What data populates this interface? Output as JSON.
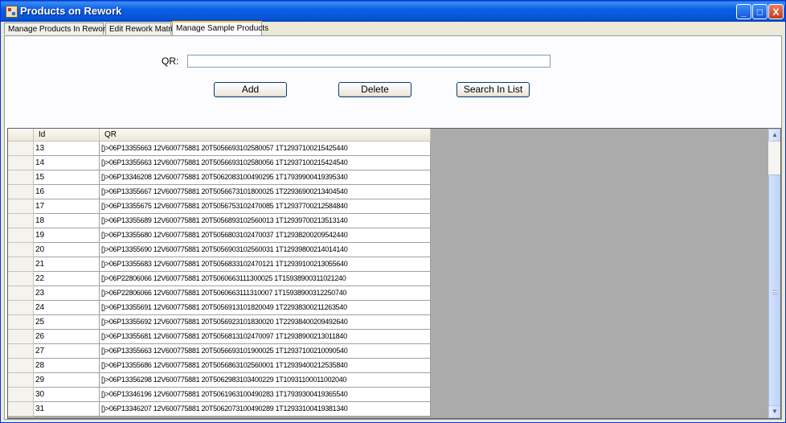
{
  "window": {
    "title": "Products on Rework",
    "minimize": "_",
    "maximize": "□",
    "close": "X"
  },
  "tabs": [
    {
      "label": "Manage Products In Rework"
    },
    {
      "label": "Edit Rework Matrix"
    },
    {
      "label": "Manage Sample Products"
    }
  ],
  "form": {
    "qr_label": "QR:",
    "qr_value": "",
    "add_label": "Add",
    "delete_label": "Delete",
    "search_label": "Search In List"
  },
  "grid": {
    "columns": [
      "Id",
      "QR"
    ],
    "rows": [
      {
        "id": "13",
        "qr": "[)>06P13355663 12V600775881 20T5056693102580057 1T12937100215425440"
      },
      {
        "id": "14",
        "qr": "[)>06P13355663 12V600775881 20T5056693102580056 1T12937100215424540"
      },
      {
        "id": "15",
        "qr": "[)>06P13346208 12V600775881 20T5062083100490295 1T17939900419395340"
      },
      {
        "id": "16",
        "qr": "[)>06P13355667 12V600775881 20T5056673101800025 1T22936900213404540"
      },
      {
        "id": "17",
        "qr": "[)>06P13355675 12V600775881 20T5056753102470085 1T12937700212584840"
      },
      {
        "id": "18",
        "qr": "[)>06P13355689 12V600775881 20T5056893102560013 1T12939700213513140"
      },
      {
        "id": "19",
        "qr": "[)>06P13355680 12V600775881 20T5056803102470037 1T12938200209542440"
      },
      {
        "id": "20",
        "qr": "[)>06P13355690 12V600775881 20T5056903102560031 1T12939800214014140"
      },
      {
        "id": "21",
        "qr": "[)>06P13355683 12V600775881 20T5056833102470121 1T12939100213055640"
      },
      {
        "id": "22",
        "qr": "[)>06P22806066 12V600775881 20T5060663111300025 1T15938900311021240"
      },
      {
        "id": "23",
        "qr": "[)>06P22806066 12V600775881 20T5060663111310007 1T15938900312250740"
      },
      {
        "id": "24",
        "qr": "[)>06P13355691 12V600775881 20T5056913101820049 1T22938300211263540"
      },
      {
        "id": "25",
        "qr": "[)>06P13355692 12V600775881 20T5056923101830020 1T22938400209492640"
      },
      {
        "id": "26",
        "qr": "[)>06P13355681 12V600775881 20T5056813102470097 1T12938900213011840"
      },
      {
        "id": "27",
        "qr": "[)>06P13355663 12V600775881 20T5056693101900025 1T12937100210090540"
      },
      {
        "id": "28",
        "qr": "[)>06P13355686 12V600775881 20T5056863102560001 1T12939400212535840"
      },
      {
        "id": "29",
        "qr": "[)>06P13356298 12V600775881 20T5062983103400229 1T10931100011002040"
      },
      {
        "id": "30",
        "qr": "[)>06P13346196 12V600775881 20T5061963100490283 1T17939300419365540"
      },
      {
        "id": "31",
        "qr": "[)>06P13346207 12V600775881 20T5062073100490289 1T12933100419381340"
      }
    ]
  }
}
